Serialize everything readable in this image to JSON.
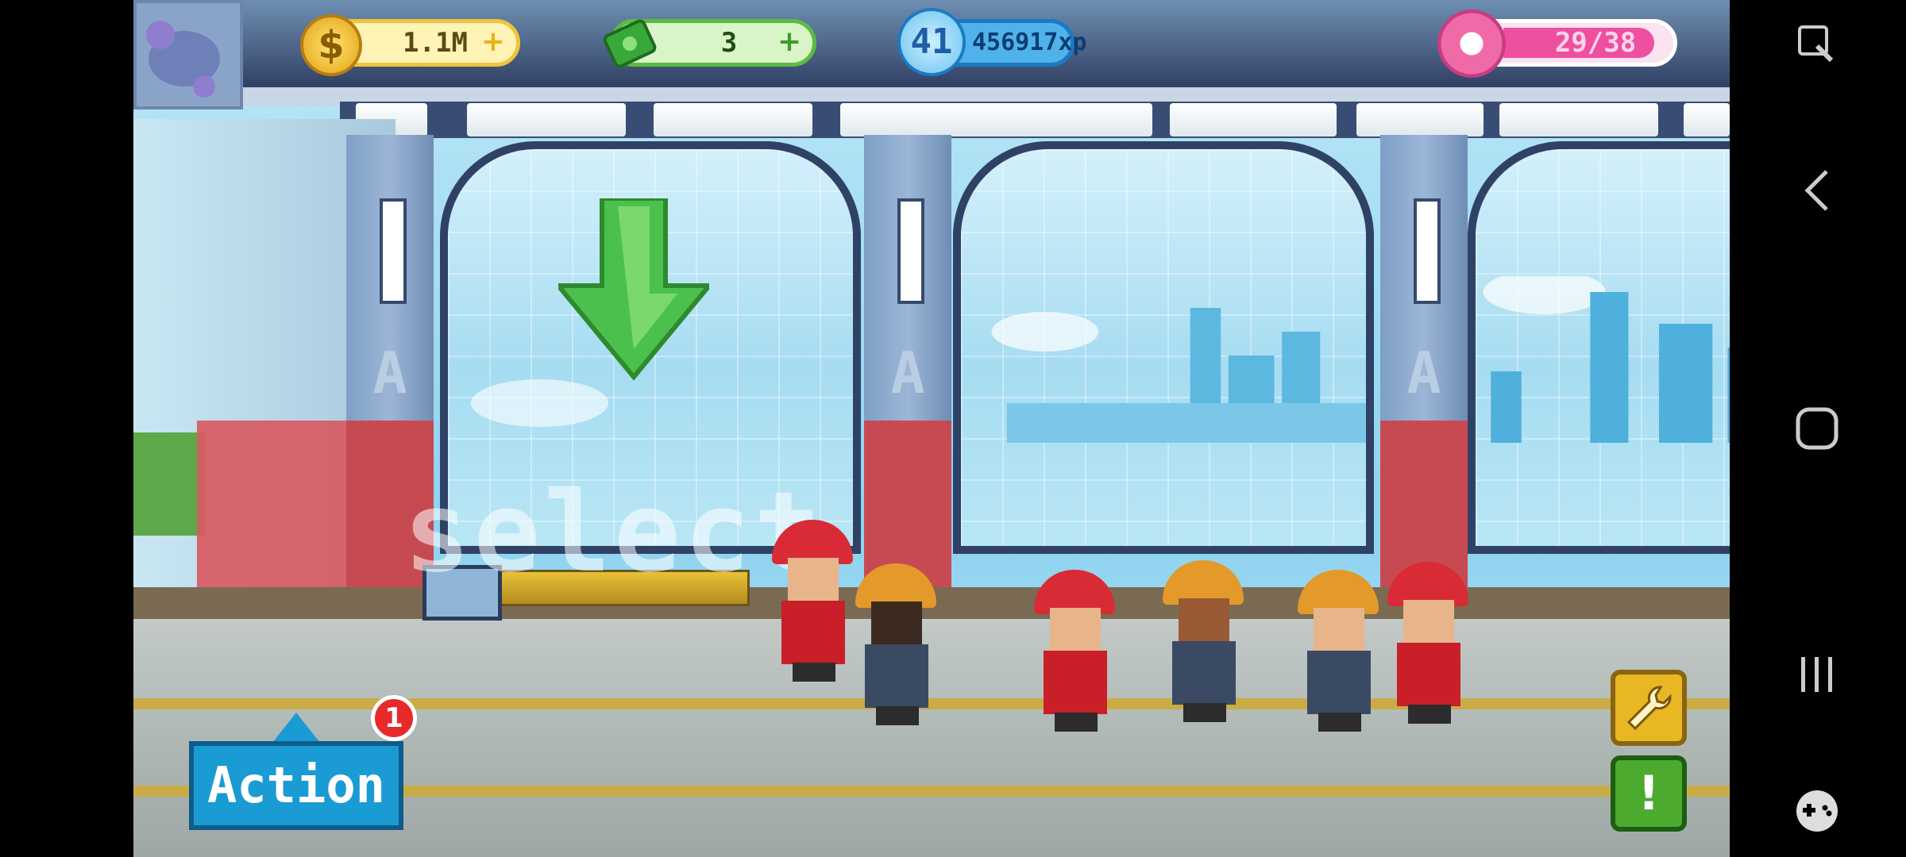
{
  "hud": {
    "coins_value": "1.1M",
    "cash_value": "3",
    "level_value": "41",
    "xp_value": "456917xp",
    "donuts_value": "29/38",
    "plus_symbol": "+"
  },
  "scene": {
    "select_text": "select",
    "pillar_logo": "A"
  },
  "controls": {
    "action_label": "Action",
    "action_badge": "1",
    "alert_label": "!"
  },
  "colors": {
    "coin_gold": "#f1c43c",
    "cash_green": "#5dbb3f",
    "xp_blue": "#1c79c5",
    "donut_pink": "#ee4f9f",
    "action_blue": "#1a9bd4",
    "badge_red": "#e62a2a"
  },
  "icons": {
    "coin": "coin-icon",
    "cash": "cash-icon",
    "level": "level-star-icon",
    "donut": "donut-icon",
    "wrench": "wrench-icon",
    "alert": "exclamation-icon",
    "nav_screenshot": "screenshot-icon",
    "nav_back": "back-icon",
    "nav_home": "home-icon",
    "nav_recents": "recents-icon",
    "nav_game": "gamepad-icon"
  }
}
